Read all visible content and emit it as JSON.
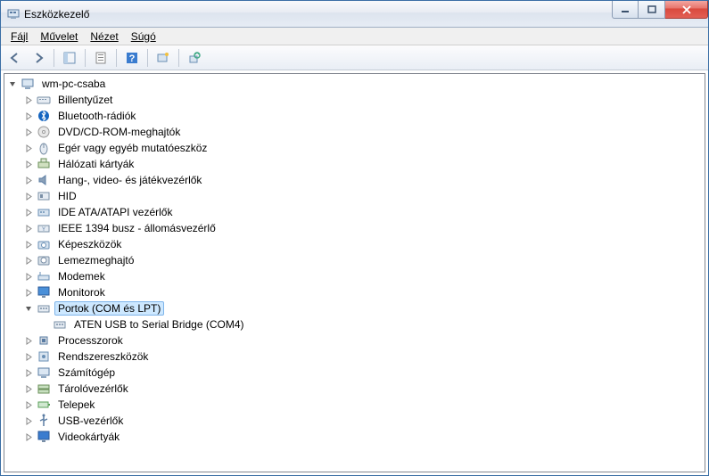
{
  "window": {
    "title": "Eszközkezelő"
  },
  "menu": {
    "file": "Fájl",
    "action": "Művelet",
    "view": "Nézet",
    "help": "Súgó"
  },
  "root": {
    "label": "wm-pc-csaba"
  },
  "nodes": [
    {
      "label": "Billentyűzet",
      "icon": "keyboard",
      "expandable": true
    },
    {
      "label": "Bluetooth-rádiók",
      "icon": "bluetooth",
      "expandable": true
    },
    {
      "label": "DVD/CD-ROM-meghajtók",
      "icon": "disc",
      "expandable": true
    },
    {
      "label": "Egér vagy egyéb mutatóeszköz",
      "icon": "mouse",
      "expandable": true
    },
    {
      "label": "Hálózati kártyák",
      "icon": "network",
      "expandable": true
    },
    {
      "label": "Hang-, video- és játékvezérlők",
      "icon": "sound",
      "expandable": true
    },
    {
      "label": "HID",
      "icon": "hid",
      "expandable": true
    },
    {
      "label": "IDE ATA/ATAPI vezérlők",
      "icon": "ide",
      "expandable": true
    },
    {
      "label": "IEEE 1394 busz - állomásvezérlő",
      "icon": "ieee",
      "expandable": true
    },
    {
      "label": "Képeszközök",
      "icon": "camera",
      "expandable": true
    },
    {
      "label": "Lemezmeghajtó",
      "icon": "hdd",
      "expandable": true
    },
    {
      "label": "Modemek",
      "icon": "modem",
      "expandable": true
    },
    {
      "label": "Monitorok",
      "icon": "monitor",
      "expandable": true
    },
    {
      "label": "Portok (COM és LPT)",
      "icon": "port",
      "expandable": true,
      "expanded": true,
      "selected": true,
      "children": [
        {
          "label": "ATEN USB to Serial Bridge (COM4)",
          "icon": "port"
        }
      ]
    },
    {
      "label": "Processzorok",
      "icon": "cpu",
      "expandable": true
    },
    {
      "label": "Rendszereszközök",
      "icon": "system",
      "expandable": true
    },
    {
      "label": "Számítógép",
      "icon": "computer",
      "expandable": true
    },
    {
      "label": "Tárolóvezérlők",
      "icon": "storage",
      "expandable": true
    },
    {
      "label": "Telepek",
      "icon": "battery",
      "expandable": true
    },
    {
      "label": "USB-vezérlők",
      "icon": "usb",
      "expandable": true
    },
    {
      "label": "Videokártyák",
      "icon": "display",
      "expandable": true
    }
  ]
}
